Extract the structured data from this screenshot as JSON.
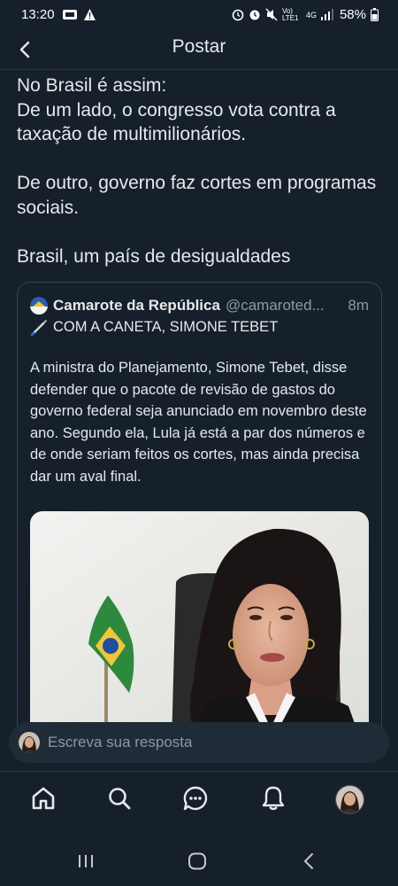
{
  "status": {
    "time": "13:20",
    "network": "Vo) LTE1",
    "network_type": "4G",
    "battery": "58%"
  },
  "header": {
    "title": "Postar",
    "back_icon": "chevron-left-icon"
  },
  "post": {
    "text": "No Brasil é assim:\nDe um lado, o congresso vota contra a taxação de multimilionários.\n\nDe outro, governo faz cortes em programas sociais.\n\nBrasil, um país de desigualdades"
  },
  "quote": {
    "name": "Camarote da República",
    "handle": "@camaroted...",
    "time": "8m",
    "subtitle": "COM A CANETA, SIMONE TEBET",
    "body": "A ministra do Planejamento, Simone Tebet, disse defender que o pacote de revisão de gastos do governo federal seja anunciado em novembro deste ano. Segundo ela, Lula já está a par dos números e de onde seriam feitos os cortes, mas ainda precisa dar um aval final."
  },
  "reply": {
    "placeholder": "Escreva sua resposta"
  },
  "nav": {
    "items": [
      "home-icon",
      "search-icon",
      "messages-icon",
      "notifications-icon",
      "profile-avatar"
    ]
  },
  "colors": {
    "background": "#15202b",
    "text": "#e7e9ea",
    "muted": "#8b98a5",
    "border": "#38444d"
  }
}
